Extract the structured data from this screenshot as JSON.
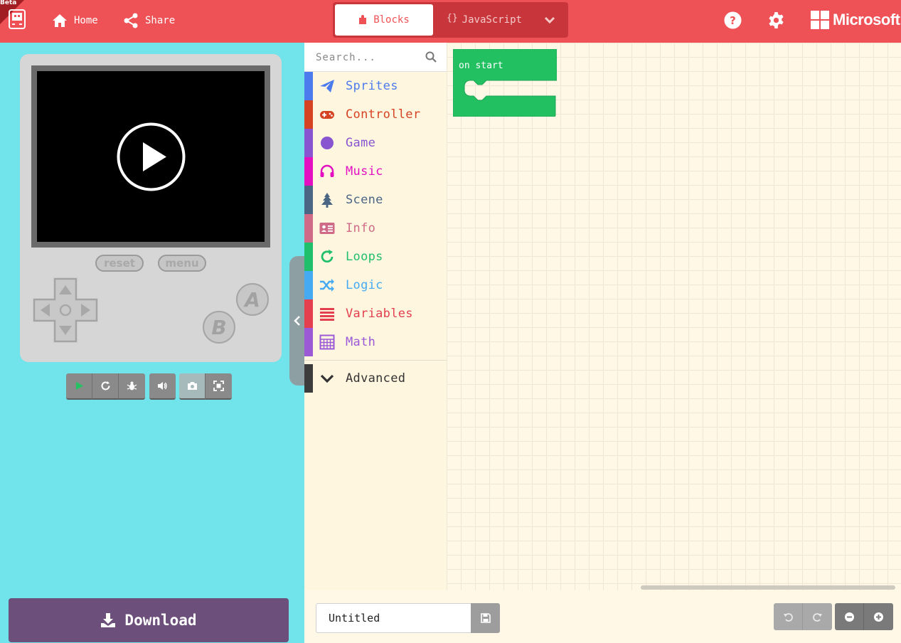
{
  "header": {
    "beta_label": "Beta",
    "home_label": "Home",
    "share_label": "Share",
    "editor_tabs": [
      {
        "label": "Blocks",
        "active": true
      },
      {
        "label": "JavaScript",
        "active": false
      }
    ],
    "brand": "Microsoft"
  },
  "simulator": {
    "reset_label": "reset",
    "menu_label": "menu",
    "button_a": "A",
    "button_b": "B",
    "toolbar": [
      "play-icon",
      "restart-icon",
      "debug-icon",
      "sound-icon",
      "screenshot-icon",
      "fullscreen-icon"
    ],
    "download_label": "Download"
  },
  "toolbox": {
    "search_placeholder": "Search...",
    "categories": [
      {
        "label": "Sprites",
        "color": "#4b7bec",
        "icon": "paper-plane-icon"
      },
      {
        "label": "Controller",
        "color": "#d54322",
        "icon": "gamepad-icon"
      },
      {
        "label": "Game",
        "color": "#8854d0",
        "icon": "circle-icon"
      },
      {
        "label": "Music",
        "color": "#e30fc0",
        "icon": "headphones-icon"
      },
      {
        "label": "Scene",
        "color": "#4b6584",
        "icon": "tree-icon"
      },
      {
        "label": "Info",
        "color": "#cf6a87",
        "icon": "id-card-icon"
      },
      {
        "label": "Loops",
        "color": "#20bf6b",
        "icon": "refresh-icon"
      },
      {
        "label": "Logic",
        "color": "#45aaf2",
        "icon": "shuffle-icon"
      },
      {
        "label": "Variables",
        "color": "#e33f4f",
        "icon": "list-icon"
      },
      {
        "label": "Math",
        "color": "#9b59d6",
        "icon": "calculator-icon"
      }
    ],
    "advanced": {
      "label": "Advanced",
      "color": "#3c3c3c"
    }
  },
  "workspace": {
    "block_label": "on start",
    "block_color": "#23c062"
  },
  "footer": {
    "project_name": "Untitled"
  },
  "colors": {
    "accent": "#ef5256",
    "sim_bg": "#71e3ea",
    "download": "#6c4f7a"
  }
}
